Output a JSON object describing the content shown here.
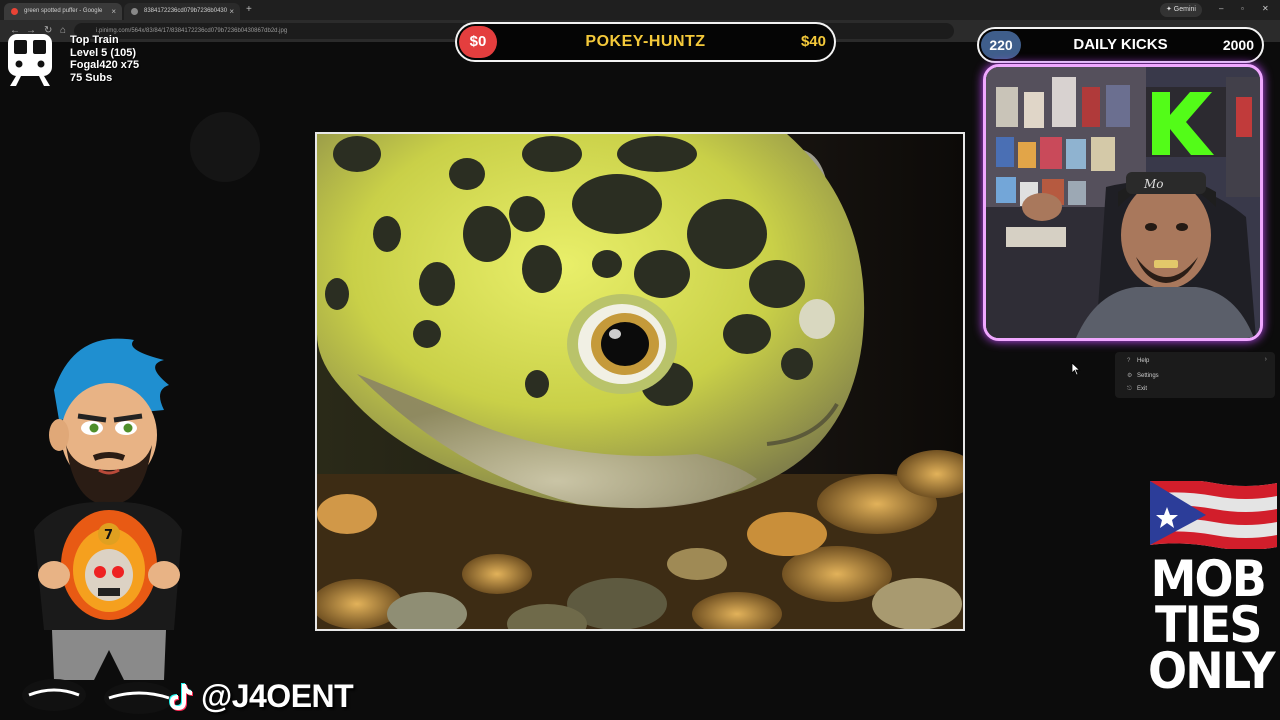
{
  "browser": {
    "tabs": [
      {
        "title": "green spotted puffer - Google",
        "close": "×"
      },
      {
        "title": "8384172236cd079b7236b0430",
        "close": "×"
      }
    ],
    "new_tab": "+",
    "gemini_label": "✦ Gemini",
    "window_controls": {
      "minimize": "–",
      "maximize": "▫",
      "close": "✕"
    },
    "url": "i.pinimg.com/564x/83/84/17/8384172236cd079b7236b0430867db2d.jpg",
    "accent_colors": {
      "tab_bg": "#3a3a3a",
      "chrome_bg": "#1f1f1f"
    }
  },
  "page": {
    "image_subject": "green spotted puffer fish photo",
    "context_menu": [
      {
        "icon": "help-icon",
        "label": "Help",
        "arrow": "›"
      },
      {
        "icon": "gear-icon",
        "label": "Settings"
      },
      {
        "icon": "exit-icon",
        "label": "Exit"
      }
    ]
  },
  "overlay": {
    "train": {
      "title": "Top Train",
      "level": "Level 5  (105)",
      "user": "Fogal420 x75",
      "subs": "75 Subs"
    },
    "pokey": {
      "left": "$0",
      "title": "POKEY-HUNTZ",
      "right": "$40",
      "left_color": "#e43e3e",
      "text_color": "#f4c93a"
    },
    "kicks": {
      "left": "220",
      "title": "DAILY KICKS",
      "right": "2000",
      "left_color": "#3f5e8b"
    },
    "webcam": {
      "frame_color": "#f0a8ff",
      "glow_color": "#c44cff"
    },
    "handle": "@J4OENT",
    "mob_lines": [
      "MOB",
      "TIES",
      "ONLY"
    ]
  }
}
